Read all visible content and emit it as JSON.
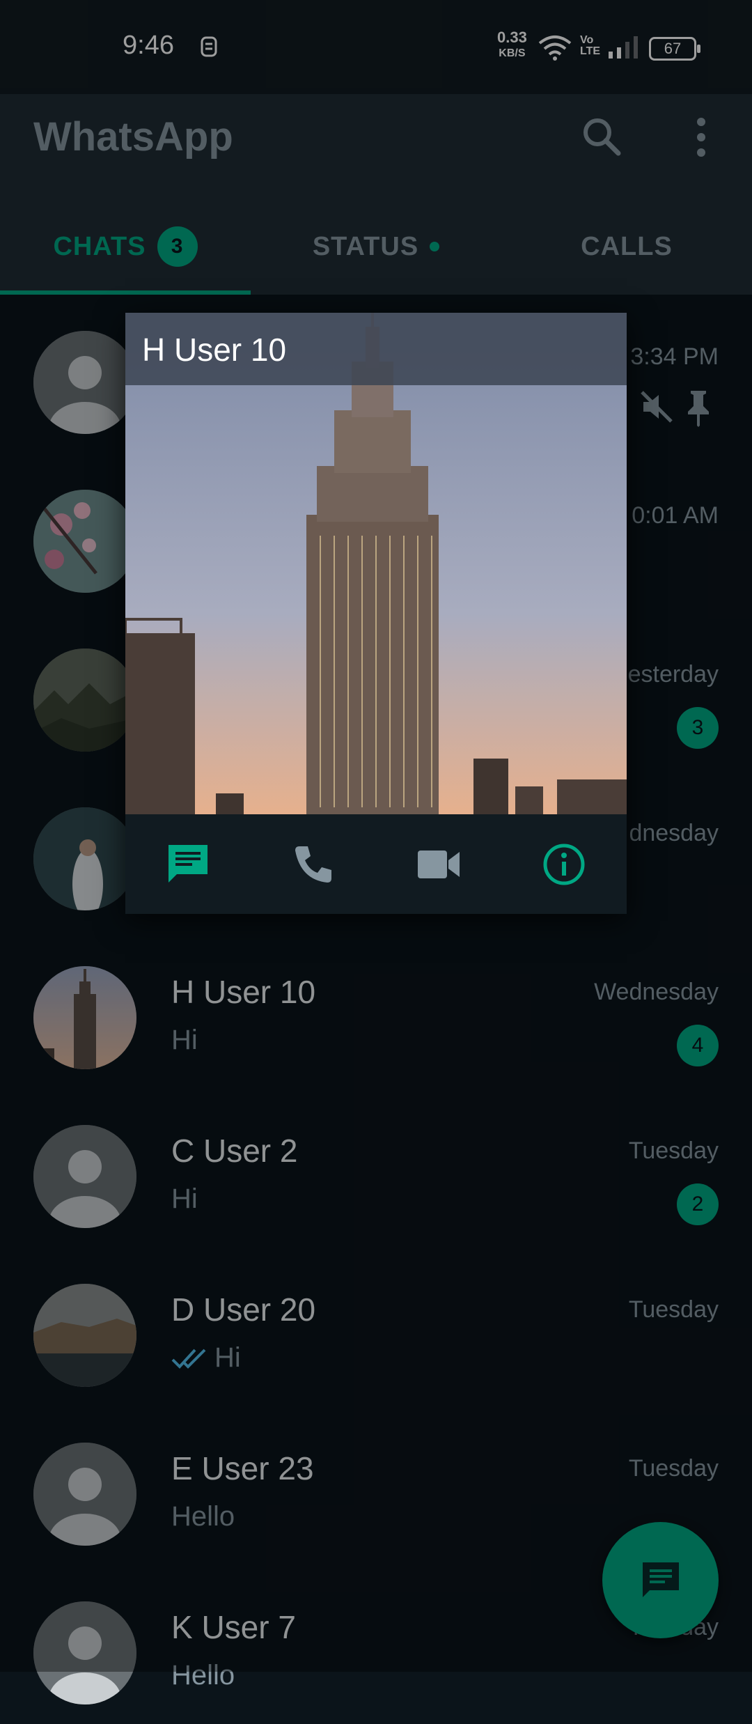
{
  "status_bar": {
    "time": "9:46",
    "net_speed_value": "0.33",
    "net_speed_unit": "KB/S",
    "volte_top": "Vo",
    "volte_bottom": "LTE",
    "battery": "67"
  },
  "app_bar": {
    "title": "WhatsApp",
    "icons": [
      "search-icon",
      "more-vert-icon"
    ]
  },
  "tabs": [
    {
      "label": "CHATS",
      "badge": "3"
    },
    {
      "label": "STATUS"
    },
    {
      "label": "CALLS"
    }
  ],
  "chats": [
    {
      "name": "",
      "message": "",
      "time": "3:34 PM",
      "muted": true,
      "pinned": true
    },
    {
      "name": "",
      "message": "",
      "time": "0:01 AM"
    },
    {
      "name": "",
      "message": "",
      "time": "esterday",
      "unread": "3"
    },
    {
      "name": "",
      "message": "",
      "time": "dnesday"
    },
    {
      "name": "H User 10",
      "message": "Hi",
      "time": "Wednesday",
      "unread": "4"
    },
    {
      "name": "C User 2",
      "message": "Hi",
      "time": "Tuesday",
      "unread": "2"
    },
    {
      "name": "D User 20",
      "message": "Hi",
      "time": "Tuesday",
      "read_ticks": true
    },
    {
      "name": "E User 23",
      "message": "Hello",
      "time": "Tuesday"
    },
    {
      "name": "K User 7",
      "message": "Hello",
      "time": "Tuesday"
    }
  ],
  "popup": {
    "title": "H User 10",
    "actions": [
      "message-icon",
      "call-icon",
      "video-icon",
      "info-icon"
    ]
  },
  "colors": {
    "accent": "#00a884",
    "background": "#0b141a",
    "app_bar": "#1f2c34"
  }
}
